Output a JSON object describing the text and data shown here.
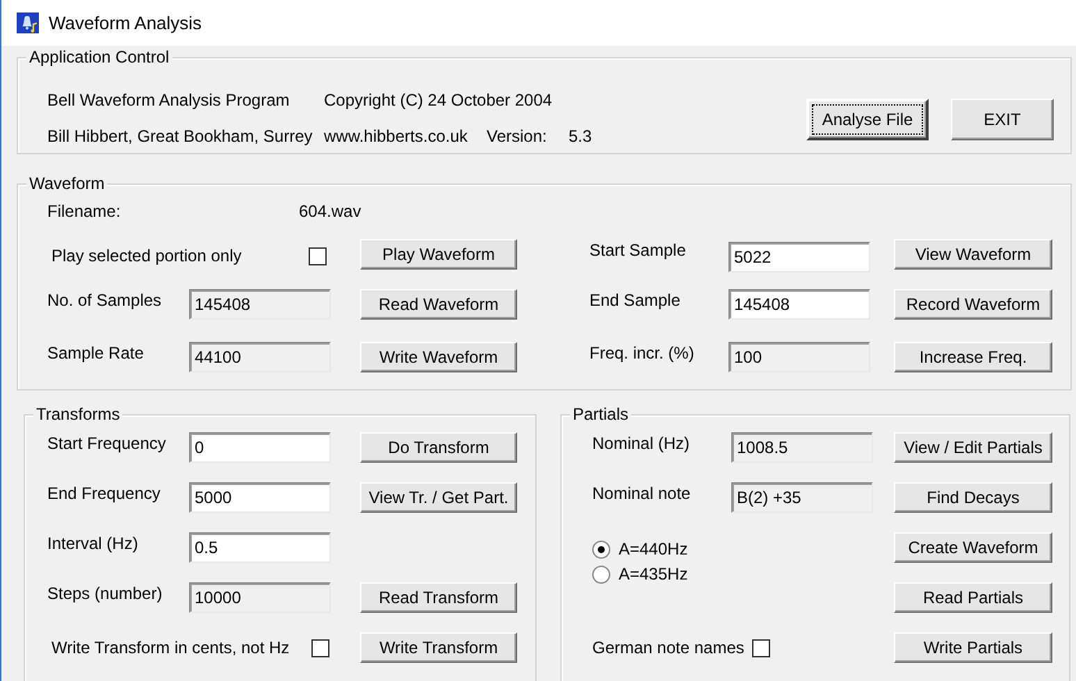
{
  "window": {
    "title": "Waveform Analysis"
  },
  "application_control": {
    "title": "Application Control",
    "program": "Bell Waveform Analysis Program",
    "copyright": "Copyright (C) 24 October 2004",
    "author": "Bill Hibbert, Great Bookham, Surrey",
    "website": "www.hibberts.co.uk",
    "version_label": "Version:",
    "version": "5.3",
    "buttons": [
      {
        "label": "Analyse File",
        "focused": true
      },
      {
        "label": "EXIT",
        "focused": false
      }
    ]
  },
  "waveform": {
    "title": "Waveform",
    "filename_label": "Filename:",
    "filename": "604.wav",
    "play_selected": {
      "label": "Play selected portion only",
      "checked": false
    },
    "left_fields": [
      {
        "label": "No. of Samples",
        "value": "145408",
        "readonly": true
      },
      {
        "label": "Sample Rate",
        "value": "44100",
        "readonly": true
      }
    ],
    "left_buttons": [
      "Play Waveform",
      "Read Waveform",
      "Write Waveform"
    ],
    "right_fields": [
      {
        "label": "Start Sample",
        "value": "5022",
        "readonly": false
      },
      {
        "label": "End Sample",
        "value": "145408",
        "readonly": false
      },
      {
        "label": "Freq. incr. (%)",
        "value": "100",
        "readonly": true
      }
    ],
    "right_buttons": [
      "View Waveform",
      "Record Waveform",
      "Increase Freq."
    ]
  },
  "transforms": {
    "title": "Transforms",
    "fields": [
      {
        "label": "Start Frequency",
        "value": "0",
        "readonly": false
      },
      {
        "label": "End Frequency",
        "value": "5000",
        "readonly": false
      },
      {
        "label": "Interval (Hz)",
        "value": "0.5",
        "readonly": false
      },
      {
        "label": "Steps (number)",
        "value": "10000",
        "readonly": true
      }
    ],
    "buttons": [
      "Do Transform",
      "View Tr. / Get Part.",
      "Read Transform",
      "Write Transform"
    ],
    "cents": {
      "label": "Write Transform in cents, not Hz",
      "checked": false
    }
  },
  "partials": {
    "title": "Partials",
    "fields": [
      {
        "label": "Nominal (Hz)",
        "value": "1008.5",
        "readonly": true
      },
      {
        "label": "Nominal note",
        "value": "B(2) +35",
        "readonly": true
      }
    ],
    "tuning": [
      {
        "label": "A=440Hz",
        "selected": true
      },
      {
        "label": "A=435Hz",
        "selected": false
      }
    ],
    "german_names": {
      "label": "German note names",
      "checked": false
    },
    "buttons": [
      "View / Edit Partials",
      "Find Decays",
      "Create Waveform",
      "Read Partials",
      "Write Partials"
    ]
  }
}
